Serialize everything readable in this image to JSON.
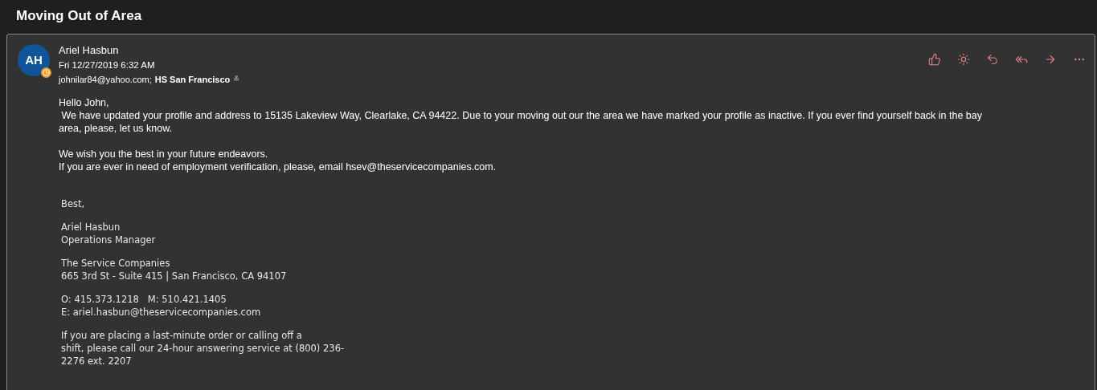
{
  "subject": "Moving Out of Area",
  "message": {
    "avatar": {
      "initials": "AH",
      "away": true
    },
    "sender": "Ariel Hasbun",
    "date": "Fri 12/27/2019 6:32 AM",
    "recipients": [
      {
        "text": "johnilar84@yahoo.com;",
        "bold": false
      },
      {
        "text": "HS San Francisco",
        "bold": true
      }
    ],
    "recipients_expand": "≚",
    "actions": [
      {
        "kind": "like"
      },
      {
        "kind": "sun"
      },
      {
        "kind": "reply"
      },
      {
        "kind": "reply-all"
      },
      {
        "kind": "forward"
      },
      {
        "kind": "more"
      }
    ],
    "body": [
      [
        "Hello John,",
        " We have updated your profile and address to 15135 Lakeview Way, Clearlake, CA 94422. Due to your moving out our the area we have marked your profile as inactive. If you ever find yourself back in the bay",
        "area, please, let us know."
      ],
      [
        "We wish you the best in your future endeavors.",
        "If you are ever in need of employment verification, please, email hsev@theservicecompanies.com."
      ]
    ],
    "signature": [
      [
        "Best,"
      ],
      [
        "Ariel Hasbun",
        "Operations Manager"
      ],
      [
        "The Service Companies",
        "665 3rd St - Suite 415 | San Francisco, CA 94107"
      ],
      [
        "O: 415.373.1218   M: 510.421.1405",
        "E: ariel.hasbun@theservicecompanies.com"
      ],
      [
        "If you are placing a last-minute order or calling off a",
        "shift, please call our 24-hour answering service at (800) 236-",
        "2276 ext. 2207"
      ]
    ]
  }
}
